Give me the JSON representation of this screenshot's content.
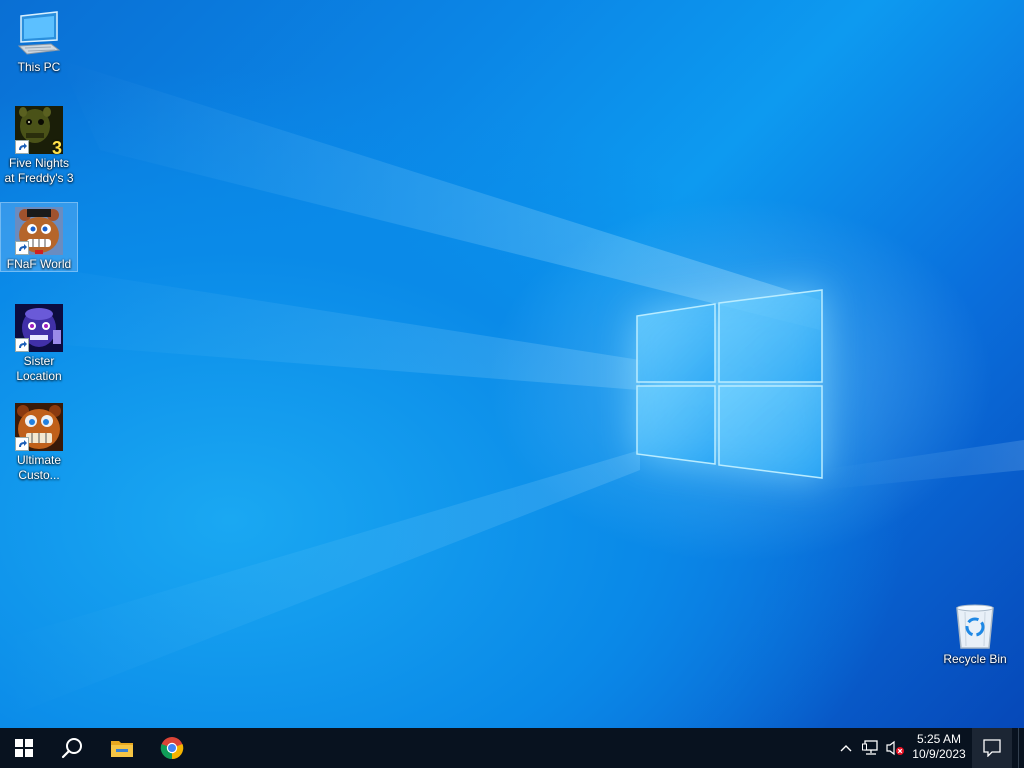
{
  "desktop": {
    "icons": [
      {
        "label": "This PC",
        "icon": "computer-icon"
      },
      {
        "label": "Five Nights at Freddy's 3",
        "icon": "fnaf3-game-icon",
        "badge": "3",
        "shortcut": true
      },
      {
        "label": "FNaF World",
        "icon": "fnaf-world-game-icon",
        "shortcut": true,
        "selected": true
      },
      {
        "label": "Sister Location",
        "icon": "sister-location-game-icon",
        "shortcut": true
      },
      {
        "label": "Ultimate Custo...",
        "icon": "ultimate-custom-night-game-icon",
        "shortcut": true
      },
      {
        "label": "Recycle Bin",
        "icon": "recycle-bin-icon"
      }
    ]
  },
  "taskbar": {
    "pinned": [
      {
        "name": "start",
        "icon": "windows-start-icon"
      },
      {
        "name": "search",
        "icon": "search-icon"
      },
      {
        "name": "file-explorer",
        "icon": "folder-icon"
      },
      {
        "name": "chrome",
        "icon": "chrome-icon"
      }
    ],
    "tray": {
      "icons": [
        "chevron-up-icon",
        "network-icon",
        "volume-muted-icon"
      ],
      "time": "5:25 AM",
      "date": "10/9/2023"
    }
  },
  "colors": {
    "taskbar": "#08121f",
    "wallpaper_blue": "#0b86e6",
    "selection": "#a0d2ff"
  }
}
